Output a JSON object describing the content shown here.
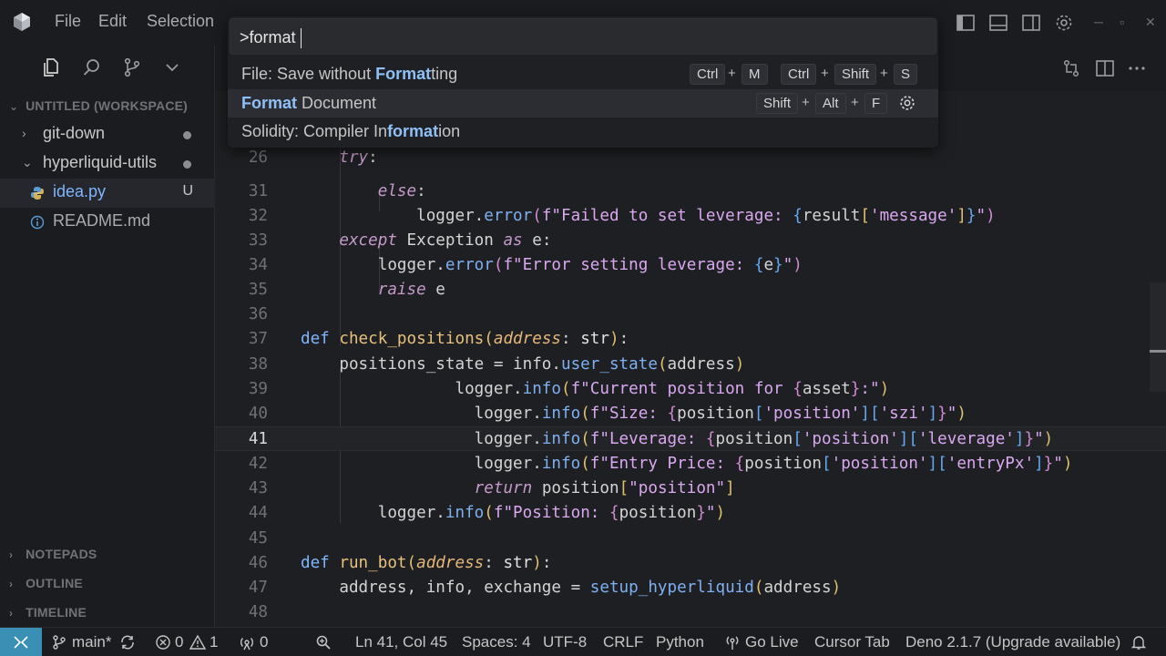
{
  "titlebar": {
    "menus": [
      "File",
      "Edit",
      "Selection"
    ]
  },
  "palette": {
    "query": ">format",
    "items": [
      {
        "pre": "File: Save without ",
        "hl": "Format",
        "post": "ting",
        "keys1": [
          "Ctrl",
          "M"
        ],
        "keys2": [
          "Ctrl",
          "Shift",
          "S"
        ]
      },
      {
        "pre": "",
        "hl": "Format",
        "post": " Document",
        "keys1": [
          "Shift",
          "Alt",
          "F"
        ]
      },
      {
        "pre": "Solidity: Compiler In",
        "hl": "format",
        "post": "ion"
      }
    ]
  },
  "sidebar": {
    "workspace": "UNTITLED (WORKSPACE)",
    "items": [
      {
        "label": "git-down"
      },
      {
        "label": "hyperliquid-utils"
      },
      {
        "label": "idea.py",
        "badge": "U"
      },
      {
        "label": "README.md"
      }
    ],
    "sections": [
      "NOTEPADS",
      "OUTLINE",
      "TIMELINE"
    ]
  },
  "editor": {
    "current_line": "41",
    "line_numbers": [
      "26",
      "31",
      "32",
      "33",
      "34",
      "35",
      "36",
      "37",
      "38",
      "39",
      "40",
      "41",
      "42",
      "43",
      "44",
      "45",
      "46",
      "47",
      "48"
    ]
  },
  "statusbar": {
    "branch": "main*",
    "errors": "0",
    "warnings": "1",
    "ports": "0",
    "cursor": "Ln 41, Col 45",
    "spaces": "Spaces: 4",
    "encoding": "UTF-8",
    "eol": "CRLF",
    "language": "Python",
    "golive": "Go Live",
    "cursortab": "Cursor Tab",
    "deno": "Deno 2.1.7 (Upgrade available)"
  },
  "colors": {
    "accent": "#3a8fb5",
    "background": "#1e1f22",
    "highlight": "#8fc0f5"
  }
}
